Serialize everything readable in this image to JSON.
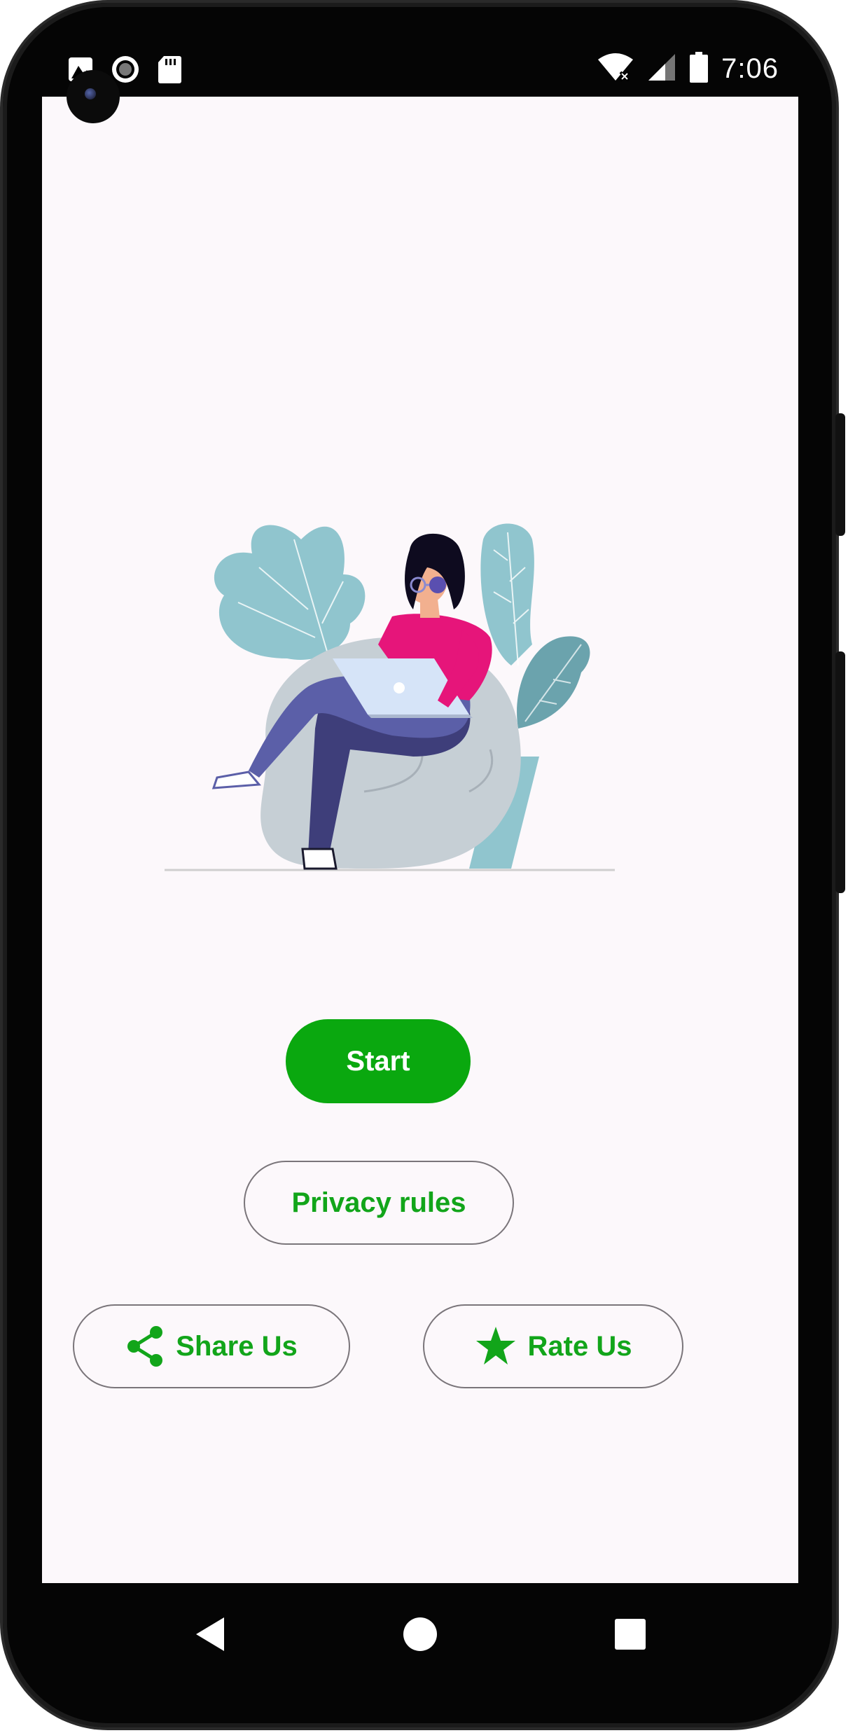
{
  "status_bar": {
    "time": "7:06",
    "left_icons": [
      "image-notification-icon",
      "record-icon",
      "sd-card-icon"
    ],
    "right_icons": [
      "wifi-icon",
      "cell-signal-icon",
      "battery-icon"
    ]
  },
  "main": {
    "illustration": "woman-on-beanbag-with-laptop",
    "start_label": "Start",
    "privacy_label": "Privacy rules",
    "share_label": "Share Us",
    "rate_label": "Rate Us"
  },
  "nav_bar": {
    "items": [
      "back-icon",
      "home-icon",
      "recents-icon"
    ]
  },
  "colors": {
    "accent": "#0aa80f",
    "accent_text": "#12a51a",
    "background": "#fcf8fb",
    "outline": "#7a757a"
  }
}
